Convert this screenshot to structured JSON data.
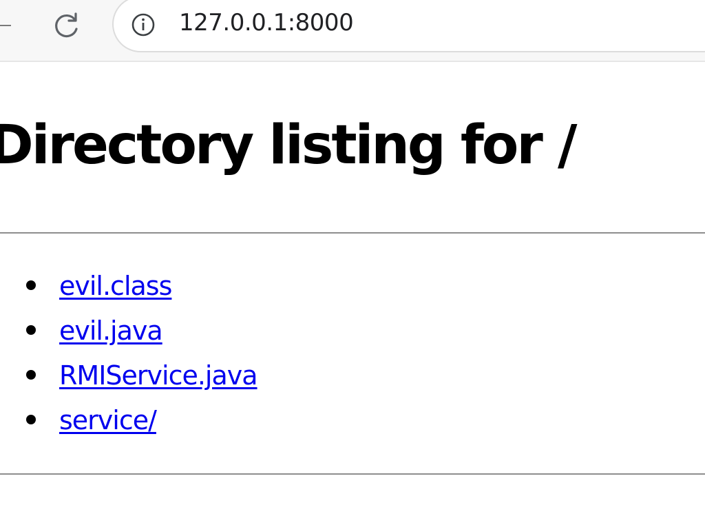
{
  "browser": {
    "url": "127.0.0.1:8000",
    "icons": {
      "reload": "reload-icon",
      "site_info": "info-icon"
    }
  },
  "page": {
    "title": "Directory listing for /",
    "entries": [
      {
        "label": "evil.class"
      },
      {
        "label": "evil.java"
      },
      {
        "label": "RMIService.java"
      },
      {
        "label": "service/"
      }
    ],
    "link_color": "#0000ee"
  }
}
